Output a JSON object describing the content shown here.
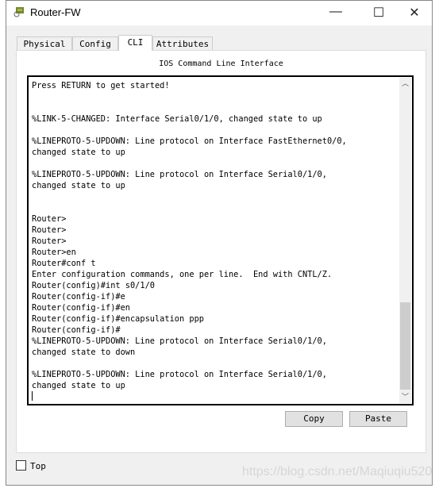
{
  "window": {
    "title": "Router-FW",
    "minimize": "—",
    "maximize": "☐",
    "close": "✕"
  },
  "tabs": [
    {
      "label": "Physical"
    },
    {
      "label": "Config"
    },
    {
      "label": "CLI",
      "active": true
    },
    {
      "label": "Attributes"
    }
  ],
  "panel": {
    "heading": "IOS Command Line Interface"
  },
  "terminal": {
    "lines": [
      "Press RETURN to get started!",
      "",
      "",
      "%LINK-5-CHANGED: Interface Serial0/1/0, changed state to up",
      "",
      "%LINEPROTO-5-UPDOWN: Line protocol on Interface FastEthernet0/0,",
      "changed state to up",
      "",
      "%LINEPROTO-5-UPDOWN: Line protocol on Interface Serial0/1/0,",
      "changed state to up",
      "",
      "",
      "Router>",
      "Router>",
      "Router>",
      "Router>en",
      "Router#conf t",
      "Enter configuration commands, one per line.  End with CNTL/Z.",
      "Router(config)#int s0/1/0",
      "Router(config-if)#e",
      "Router(config-if)#en",
      "Router(config-if)#encapsulation ppp",
      "Router(config-if)#",
      "%LINEPROTO-5-UPDOWN: Line protocol on Interface Serial0/1/0,",
      "changed state to down",
      "",
      "%LINEPROTO-5-UPDOWN: Line protocol on Interface Serial0/1/0,",
      "changed state to up"
    ]
  },
  "buttons": {
    "copy": "Copy",
    "paste": "Paste"
  },
  "top_checkbox": {
    "label": "Top",
    "checked": false
  },
  "watermark": "https://blog.csdn.net/Maqiuqiu520"
}
